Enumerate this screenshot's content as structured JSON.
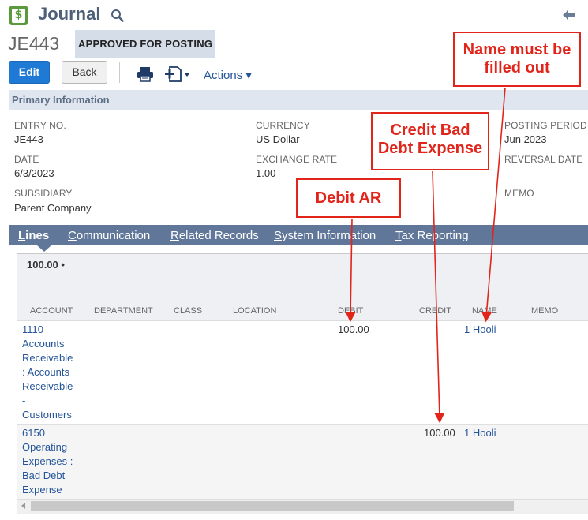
{
  "header": {
    "app_glyph": "$",
    "title": "Journal",
    "record_id": "JE443",
    "status": "APPROVED FOR POSTING"
  },
  "toolbar": {
    "edit_label": "Edit",
    "back_label": "Back",
    "actions_label": "Actions ▾"
  },
  "primary": {
    "section_title": "Primary Information",
    "fields": {
      "entry_no_label": "ENTRY NO.",
      "entry_no": "JE443",
      "date_label": "DATE",
      "date": "6/3/2023",
      "subsidiary_label": "SUBSIDIARY",
      "subsidiary": "Parent Company",
      "currency_label": "CURRENCY",
      "currency": "US Dollar",
      "exchange_rate_label": "EXCHANGE RATE",
      "exchange_rate": "1.00",
      "posting_period_label": "POSTING PERIOD",
      "posting_period": "Jun 2023",
      "reversal_date_label": "REVERSAL DATE",
      "memo_label": "MEMO"
    }
  },
  "tabs": [
    {
      "first": "L",
      "rest": "ines"
    },
    {
      "first": "C",
      "rest": "ommunication"
    },
    {
      "first": "R",
      "rest": "elated Records"
    },
    {
      "first": "S",
      "rest": "ystem Information"
    },
    {
      "first": "T",
      "rest": "ax Reporting"
    }
  ],
  "grid": {
    "subtotal": "100.00 •",
    "columns": [
      "ACCOUNT",
      "DEPARTMENT",
      "CLASS",
      "LOCATION",
      "DEBIT",
      "CREDIT",
      "NAME",
      "MEMO"
    ],
    "rows": [
      {
        "account_lines": [
          "1110",
          "Accounts",
          "Receivable",
          ": Accounts",
          "Receivable",
          "-",
          "Customers"
        ],
        "debit": "100.00",
        "credit": "",
        "name": "1 Hooli"
      },
      {
        "account_lines": [
          "6150",
          "Operating",
          "Expenses :",
          "Bad Debt",
          "Expense"
        ],
        "debit": "",
        "credit": "100.00",
        "name": "1 Hooli"
      }
    ]
  },
  "annotations": {
    "name_note": [
      "Name must be",
      "filled out"
    ],
    "credit_note": [
      "Credit Bad",
      "Debt Expense"
    ],
    "debit_note": "Debit AR",
    "color": "#e1251b"
  },
  "colors": {
    "primary_button": "#1f7ad6",
    "tab_bar": "#607799",
    "section_header": "#e0e6ef",
    "link": "#255599"
  }
}
